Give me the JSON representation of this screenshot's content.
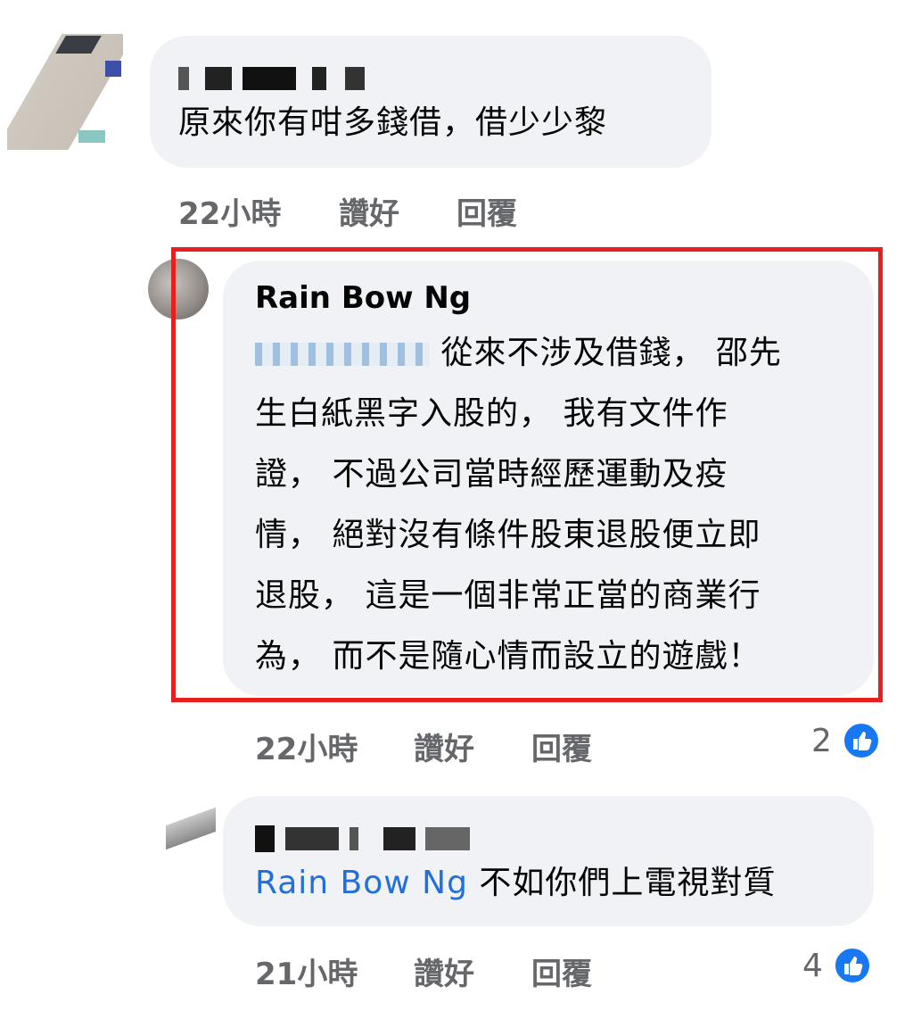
{
  "comments": [
    {
      "text": "原來你有咁多錢借，借少少黎",
      "time": "22小時",
      "like": "讚好",
      "reply": "回覆"
    },
    {
      "author": "Rain Bow Ng",
      "lines": [
        "從來不涉及借錢， 邵先",
        "生白紙黑字入股的， 我有文件作",
        "證， 不過公司當時經歷運動及疫",
        "情， 絕對沒有條件股東退股便立即",
        "退股， 這是一個非常正當的商業行",
        "為， 而不是隨心情而設立的遊戲！"
      ],
      "time": "22小時",
      "like": "讚好",
      "reply": "回覆",
      "like_count": "2",
      "highlight_color": "#e5201f"
    },
    {
      "mention": "Rain Bow Ng",
      "text": "不如你們上電視對質",
      "time": "21小時",
      "like": "讚好",
      "reply": "回覆",
      "like_count": "4"
    }
  ],
  "icons": {
    "reaction": "like-thumb-icon"
  },
  "colors": {
    "bubble": "#f0f2f5",
    "meta": "#65676b",
    "mention": "#216fdb",
    "like": "#1877f2"
  }
}
